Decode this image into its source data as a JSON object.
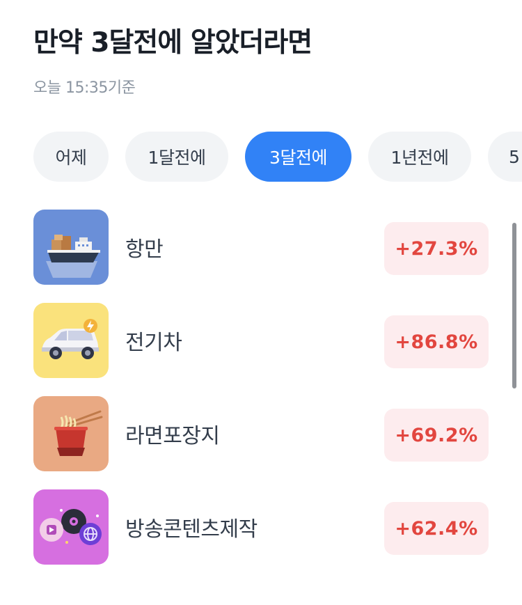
{
  "header": {
    "title": "만약 3달전에 알았더라면",
    "timestamp": "오늘 15:35기준"
  },
  "period_tabs": [
    {
      "label": "어제",
      "selected": false
    },
    {
      "label": "1달전에",
      "selected": false
    },
    {
      "label": "3달전에",
      "selected": true
    },
    {
      "label": "1년전에",
      "selected": false
    },
    {
      "label": "5",
      "selected": false
    }
  ],
  "themes": [
    {
      "name": "항만",
      "change": "+27.3%",
      "icon": "cargo-ship-icon",
      "icon_bg": "#6a8fd8"
    },
    {
      "name": "전기차",
      "change": "+86.8%",
      "icon": "electric-car-icon",
      "icon_bg": "#fae27c"
    },
    {
      "name": "라면포장지",
      "change": "+69.2%",
      "icon": "noodle-cup-icon",
      "icon_bg": "#e9a983"
    },
    {
      "name": "방송콘텐츠제작",
      "change": "+62.4%",
      "icon": "broadcast-media-icon",
      "icon_bg": "#d66fe0"
    }
  ],
  "colors": {
    "accent": "#3182f6",
    "rise": "#e2463f",
    "rise_bg": "#fdecee",
    "chip_bg": "#f2f4f6"
  }
}
